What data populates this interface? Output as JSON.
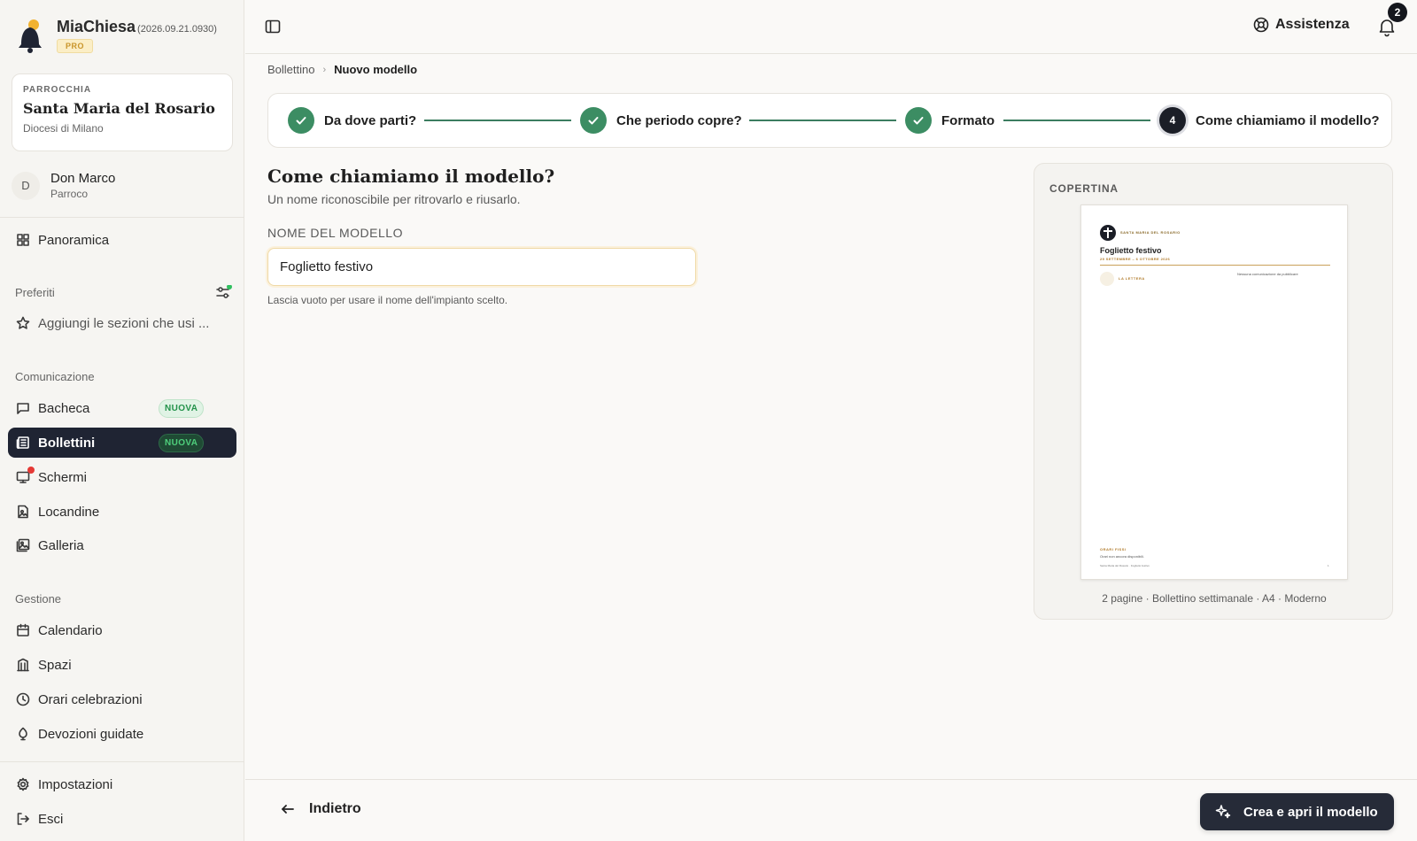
{
  "brand": {
    "name": "MiaChiesa",
    "version": "(2026.09.21.0930)",
    "plan": "PRO"
  },
  "parish": {
    "label": "PARROCCHIA",
    "name": "Santa Maria del Rosario",
    "diocese": "Diocesi di Milano"
  },
  "user": {
    "initial": "D",
    "name": "Don Marco",
    "role": "Parroco"
  },
  "nav": {
    "overview": "Panoramica",
    "favorites_label": "Preferiti",
    "favorites_hint": "Aggiungi le sezioni che usi ...",
    "communication_label": "Comunicazione",
    "communication": [
      {
        "label": "Bacheca",
        "badge": "NUOVA",
        "icon": "message-square-icon"
      },
      {
        "label": "Bollettini",
        "badge": "NUOVA",
        "icon": "newspaper-icon",
        "active": true
      },
      {
        "label": "Schermi",
        "icon": "monitor-icon",
        "alert": true
      },
      {
        "label": "Locandine",
        "icon": "file-image-icon"
      },
      {
        "label": "Galleria",
        "icon": "images-icon"
      }
    ],
    "management_label": "Gestione",
    "management": [
      {
        "label": "Calendario",
        "icon": "calendar-icon"
      },
      {
        "label": "Spazi",
        "icon": "building-icon"
      },
      {
        "label": "Orari celebrazioni",
        "icon": "clock-icon"
      },
      {
        "label": "Devozioni guidate",
        "icon": "candle-icon"
      }
    ],
    "settings": "Impostazioni",
    "logout": "Esci"
  },
  "topbar": {
    "help": "Assistenza",
    "notifications_count": "2"
  },
  "breadcrumb": {
    "parent": "Bollettino",
    "current": "Nuovo modello"
  },
  "stepper": {
    "steps": [
      {
        "label": "Da dove parti?",
        "state": "done"
      },
      {
        "label": "Che periodo copre?",
        "state": "done"
      },
      {
        "label": "Formato",
        "state": "done"
      },
      {
        "number": "4",
        "label": "Come chiamiamo il modello?",
        "state": "current"
      }
    ]
  },
  "form": {
    "title": "Come chiamiamo il modello?",
    "subtitle": "Un nome riconoscibile per ritrovarlo e riusarlo.",
    "field_label": "NOME DEL MODELLO",
    "field_value": "Foglietto festivo",
    "field_hint": "Lascia vuoto per usare il nome dell'impianto scelto."
  },
  "preview": {
    "label": "COPERTINA",
    "doc": {
      "parish": "SANTA MARIA DEL ROSARIO",
      "title": "Foglietto festivo",
      "dates": "29 SETTEMBRE – 6 OTTOBRE 2026",
      "letter": "LA LETTERA",
      "no_comms": "Nessuna comunicazione da pubblicare",
      "orari": "ORARI FISSI",
      "orari_sub": "Orari non ancora disponibili.",
      "footer": "Santa Maria del Rosario · Foglietto festivo",
      "page": "1"
    },
    "caption": "2 pagine · Bollettino settimanale · A4 · Moderno"
  },
  "footer": {
    "back": "Indietro",
    "create": "Crea e apri il modello"
  },
  "colors": {
    "accent_green": "#3c8d63",
    "active_nav": "#1f2433",
    "badge_green": "#23924a",
    "alert_red": "#e53935"
  }
}
